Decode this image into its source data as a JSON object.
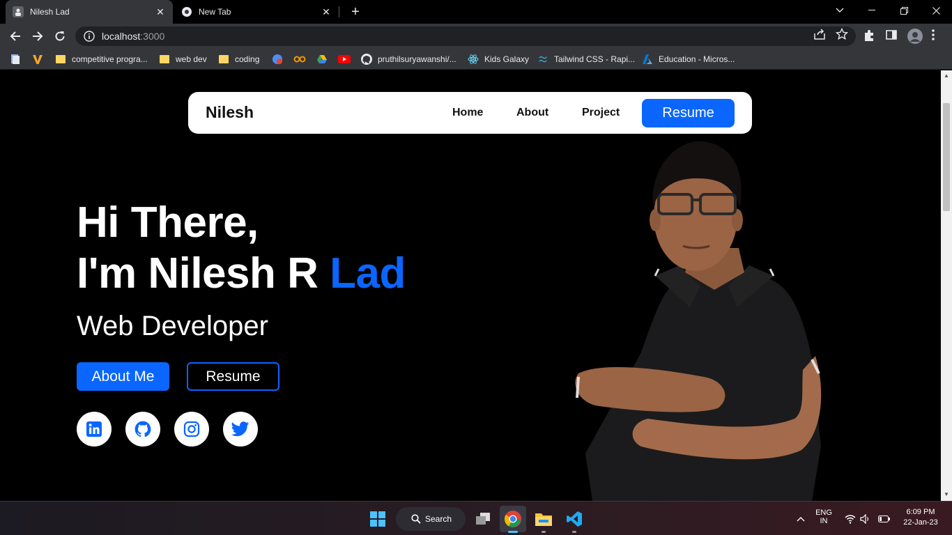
{
  "browser": {
    "tabs": [
      {
        "title": "Nilesh Lad",
        "active": true
      },
      {
        "title": "New Tab",
        "active": false
      }
    ],
    "url_host": "localhost",
    "url_port": ":3000",
    "bookmarks": [
      {
        "label": "competitive progra...",
        "type": "folder"
      },
      {
        "label": "web dev",
        "type": "folder"
      },
      {
        "label": "coding",
        "type": "folder"
      },
      {
        "label": "pruthilsuryawanshi/...",
        "type": "link"
      },
      {
        "label": "Kids Galaxy",
        "type": "link"
      },
      {
        "label": "Tailwind CSS - Rapi...",
        "type": "link"
      },
      {
        "label": "Education - Micros...",
        "type": "link"
      }
    ]
  },
  "site": {
    "brand": "Nilesh",
    "nav": {
      "home": "Home",
      "about": "About",
      "project": "Project",
      "resume": "Resume"
    },
    "hero": {
      "greeting": "Hi There,",
      "intro_prefix": "I'm Nilesh R ",
      "intro_accent": "Lad",
      "role": "Web Developer",
      "about_button": "About Me",
      "resume_button": "Resume"
    },
    "socials": [
      "linkedin-icon",
      "github-icon",
      "instagram-icon",
      "twitter-icon"
    ],
    "accent_color": "#0a66ff"
  },
  "taskbar": {
    "search_label": "Search",
    "lang_top": "ENG",
    "lang_bottom": "IN",
    "time": "6:09 PM",
    "date": "22-Jan-23"
  }
}
